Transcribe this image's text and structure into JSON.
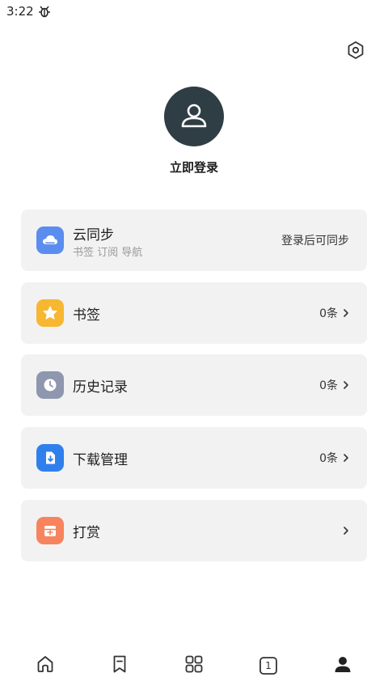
{
  "status_bar": {
    "time": "3:22",
    "notification_icon": "bug-icon"
  },
  "header": {
    "settings_icon": "gear-hexagon-icon"
  },
  "profile": {
    "avatar_icon": "user-outline-icon",
    "login_label": "立即登录"
  },
  "menu": {
    "cloud_sync": {
      "title": "云同步",
      "subtitle": "书签 订阅 导航",
      "status": "登录后可同步",
      "icon": "cloud-icon",
      "icon_color": "#5b8def"
    },
    "bookmarks": {
      "title": "书签",
      "count": "0条",
      "icon": "star-icon",
      "icon_color": "#f7b731"
    },
    "history": {
      "title": "历史记录",
      "count": "0条",
      "icon": "clock-icon",
      "icon_color": "#8e97ad"
    },
    "downloads": {
      "title": "下载管理",
      "count": "0条",
      "icon": "download-file-icon",
      "icon_color": "#2f80ed"
    },
    "reward": {
      "title": "打赏",
      "icon": "gift-icon",
      "icon_color": "#f7845e"
    }
  },
  "bottom_nav": {
    "items": [
      {
        "icon": "home-icon"
      },
      {
        "icon": "bookmark-icon"
      },
      {
        "icon": "grid-icon"
      },
      {
        "icon": "tabs-icon",
        "label": "1"
      },
      {
        "icon": "profile-icon"
      }
    ]
  }
}
